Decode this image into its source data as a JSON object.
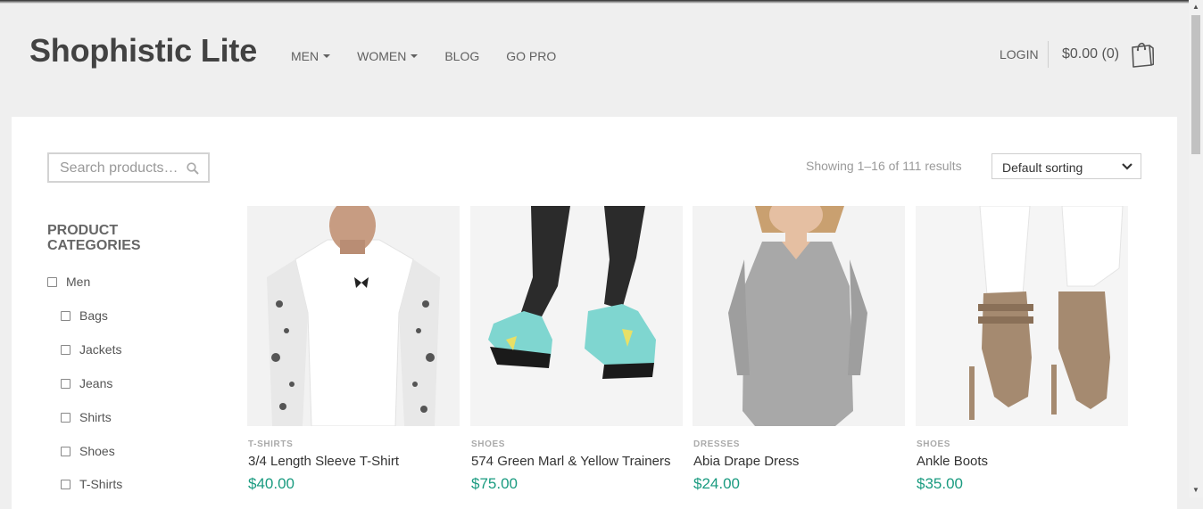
{
  "header": {
    "site_title": "Shophistic Lite",
    "nav": [
      {
        "label": "MEN",
        "has_dropdown": true
      },
      {
        "label": "WOMEN",
        "has_dropdown": true
      },
      {
        "label": "BLOG",
        "has_dropdown": false
      },
      {
        "label": "GO PRO",
        "has_dropdown": false
      }
    ],
    "login_label": "LOGIN",
    "cart_total": "$0.00 (0)",
    "cart_icon": "shopping-bag-icon"
  },
  "shop": {
    "search_placeholder": "Search products…",
    "results_text": "Showing 1–16 of 111 results",
    "sorting_selected": "Default sorting",
    "categories_title": "PRODUCT CATEGORIES",
    "categories": [
      {
        "label": "Men"
      },
      {
        "label": "Bags"
      },
      {
        "label": "Jackets"
      },
      {
        "label": "Jeans"
      },
      {
        "label": "Shirts"
      },
      {
        "label": "Shoes"
      },
      {
        "label": "T-Shirts"
      }
    ],
    "products": [
      {
        "category": "T-SHIRTS",
        "name": "3/4 Length Sleeve T-Shirt",
        "price": "$40.00"
      },
      {
        "category": "SHOES",
        "name": "574 Green Marl & Yellow Trainers",
        "price": "$75.00"
      },
      {
        "category": "DRESSES",
        "name": "Abia Drape Dress",
        "price": "$24.00"
      },
      {
        "category": "SHOES",
        "name": "Ankle Boots",
        "price": "$35.00"
      }
    ]
  },
  "colors": {
    "price": "#1a9b80",
    "background": "#efefef",
    "content_bg": "#ffffff"
  }
}
